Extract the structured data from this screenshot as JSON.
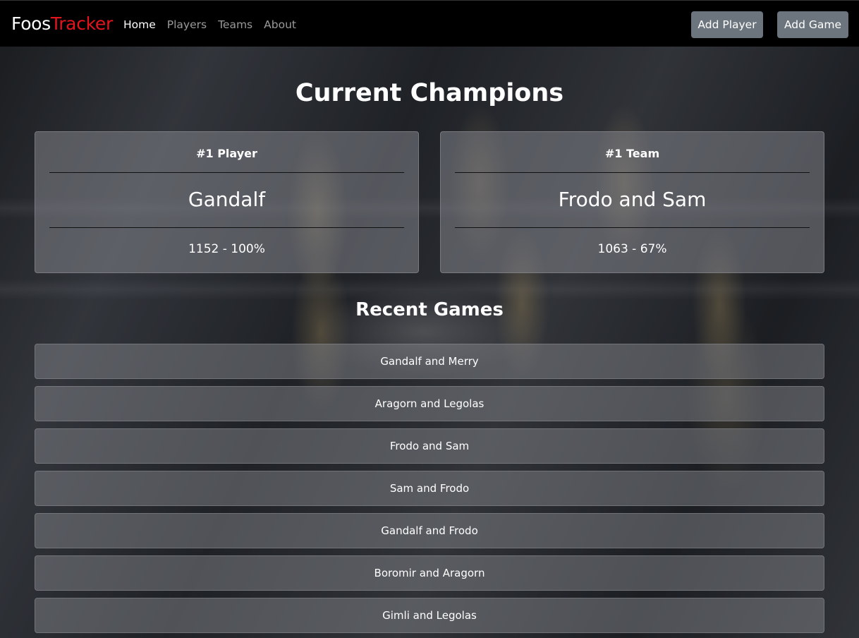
{
  "navbar": {
    "brand_first": "Foos",
    "brand_second": "Tracker",
    "links": [
      "Home",
      "Players",
      "Teams",
      "About"
    ],
    "add_player": "Add Player",
    "add_game": "Add Game"
  },
  "champions": {
    "title": "Current Champions",
    "player": {
      "label": "#1 Player",
      "name": "Gandalf",
      "stat": "1152 - 100%"
    },
    "team": {
      "label": "#1 Team",
      "name": "Frodo and Sam",
      "stat": "1063 - 67%"
    }
  },
  "recent": {
    "title": "Recent Games",
    "games": [
      "Gandalf and Merry",
      "Aragorn and Legolas",
      "Frodo and Sam",
      "Sam and Frodo",
      "Gandalf and Frodo",
      "Boromir and Aragorn",
      "Gimli and Legolas"
    ]
  },
  "colors": {
    "accent": "#e2141e",
    "navbar": "#000000",
    "button": "#6c757d"
  }
}
